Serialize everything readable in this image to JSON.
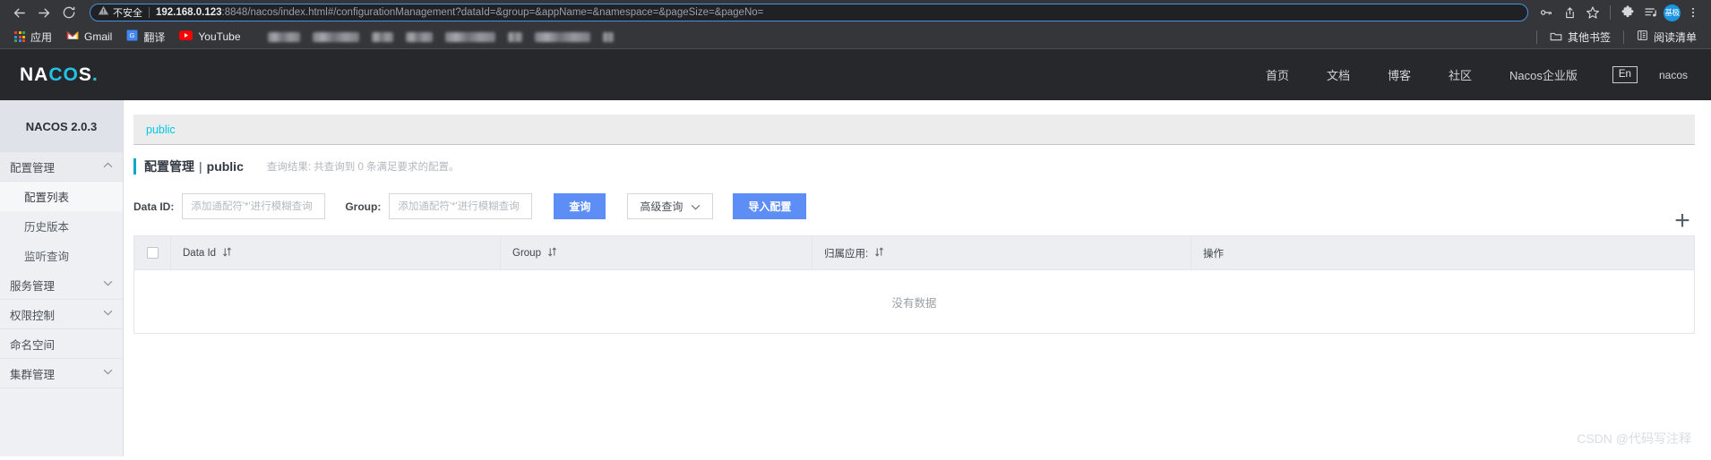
{
  "browser": {
    "nav": {
      "back_icon": "arrow-left-icon",
      "forward_icon": "arrow-right-icon",
      "reload_icon": "reload-icon"
    },
    "omnibox": {
      "warning_icon": "warning-triangle-icon",
      "insecure_label": "不安全",
      "url_host": "192.168.0.123",
      "url_rest": ":8848/nacos/index.html#/configurationManagement?dataId=&group=&appName=&namespace=&pageSize=&pageNo="
    },
    "toolbar_icons": [
      {
        "name": "password-key-icon"
      },
      {
        "name": "share-icon"
      },
      {
        "name": "bookmark-star-icon"
      },
      {
        "name": "extensions-puzzle-icon"
      },
      {
        "name": "media-playlist-icon"
      }
    ],
    "avatar_label": "基极",
    "menu_icon": "three-dot-menu-icon",
    "bookmarks": [
      {
        "label": "应用",
        "icon": "apps-grid-icon"
      },
      {
        "label": "Gmail",
        "icon": "gmail-icon"
      },
      {
        "label": "翻译",
        "icon": "google-translate-icon"
      },
      {
        "label": "YouTube",
        "icon": "youtube-icon"
      }
    ],
    "bookmarks_right": [
      {
        "label": "其他书签",
        "icon": "folder-icon"
      },
      {
        "label": "阅读清单",
        "icon": "reading-list-icon"
      }
    ]
  },
  "nacos_header": {
    "logo_left": "NA",
    "logo_mid": "CO",
    "logo_right": "S",
    "logo_dot": ".",
    "nav": [
      {
        "label": "首页"
      },
      {
        "label": "文档"
      },
      {
        "label": "博客"
      },
      {
        "label": "社区"
      },
      {
        "label": "Nacos企业版"
      }
    ],
    "lang_button": "En",
    "user": "nacos"
  },
  "sidebar": {
    "title": "NACOS 2.0.3",
    "items": [
      {
        "label": "配置管理",
        "type": "group",
        "expanded": true,
        "chevron": "▲"
      },
      {
        "label": "配置列表",
        "type": "sub",
        "active": true
      },
      {
        "label": "历史版本",
        "type": "sub",
        "active": false
      },
      {
        "label": "监听查询",
        "type": "sub",
        "active": false
      },
      {
        "label": "服务管理",
        "type": "group",
        "expanded": false,
        "chevron": "▼"
      },
      {
        "label": "权限控制",
        "type": "group",
        "expanded": false,
        "chevron": "▼"
      },
      {
        "label": "命名空间",
        "type": "group",
        "expanded": null,
        "chevron": ""
      },
      {
        "label": "集群管理",
        "type": "group",
        "expanded": false,
        "chevron": "▼"
      }
    ]
  },
  "main": {
    "tab_label": "public",
    "title": "配置管理",
    "title_sep": "|",
    "title_namespace": "public",
    "result_note": "查询结果: 共查询到 0 条满足要求的配置。",
    "filters": {
      "dataid_label": "Data ID:",
      "dataid_value": "",
      "dataid_placeholder": "添加通配符'*'进行模糊查询",
      "group_label": "Group:",
      "group_value": "",
      "group_placeholder": "添加通配符'*'进行模糊查询",
      "query_button": "查询",
      "advanced_button": "高级查询",
      "advanced_chevron": "∨",
      "import_button": "导入配置",
      "add_button": "+"
    },
    "table": {
      "columns": [
        {
          "key": "checkbox",
          "label": ""
        },
        {
          "key": "dataId",
          "label": "Data Id",
          "sortable": true,
          "sort_glyph": "⇵"
        },
        {
          "key": "group",
          "label": "Group",
          "sortable": true,
          "sort_glyph": "⇵"
        },
        {
          "key": "app",
          "label": "归属应用:",
          "sortable": true,
          "sort_glyph": "⇵"
        },
        {
          "key": "ops",
          "label": "操作",
          "sortable": false,
          "sort_glyph": ""
        }
      ],
      "rows": [],
      "empty_text": "没有数据"
    }
  },
  "watermark": "CSDN @代码写注释",
  "colors": {
    "chrome_bg": "#35363a",
    "omnibox_bg": "#202124",
    "omnibox_border": "#4a90e2",
    "nacos_header_bg": "#26282c",
    "logo_cyan": "#23c3e8",
    "sidebar_bg": "#eef0f3",
    "tab_cyan": "#00c7e6",
    "accent_bar": "#00a8d0",
    "primary_button": "#5c8ef5"
  }
}
